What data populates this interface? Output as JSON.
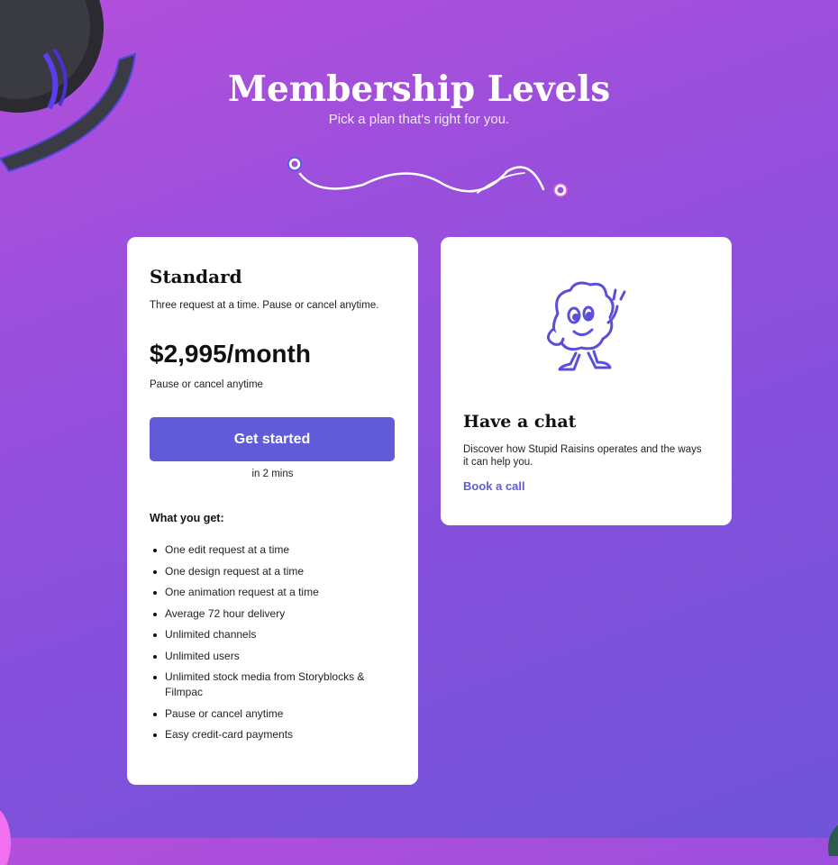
{
  "header": {
    "title": "Membership Levels",
    "subtitle": "Pick a plan that's right for you."
  },
  "colors": {
    "accent": "#625bd9",
    "background_start": "#b44fdc",
    "background_end": "#6f55d8",
    "card": "#ffffff"
  },
  "standard_plan": {
    "name": "Standard",
    "description": "Three request at a time. Pause or cancel anytime.",
    "price": "$2,995/month",
    "price_note": "Pause or cancel anytime",
    "cta_label": "Get started",
    "cta_note": "in 2 mins",
    "features_heading": "What you get:",
    "features": [
      "One edit request at a time",
      "One design request at a time",
      "One animation request at a time",
      "Average 72 hour delivery",
      "Unlimited channels",
      "Unlimited users",
      "Unlimited stock media from Storyblocks & Filmpac",
      "Pause or cancel anytime",
      "Easy credit-card payments"
    ]
  },
  "chat_card": {
    "mascot_icon": "raisin-mascot-icon",
    "title": "Have a chat",
    "description": "Discover how Stupid Raisins operates and the ways it can help you.",
    "link_label": "Book a call"
  }
}
